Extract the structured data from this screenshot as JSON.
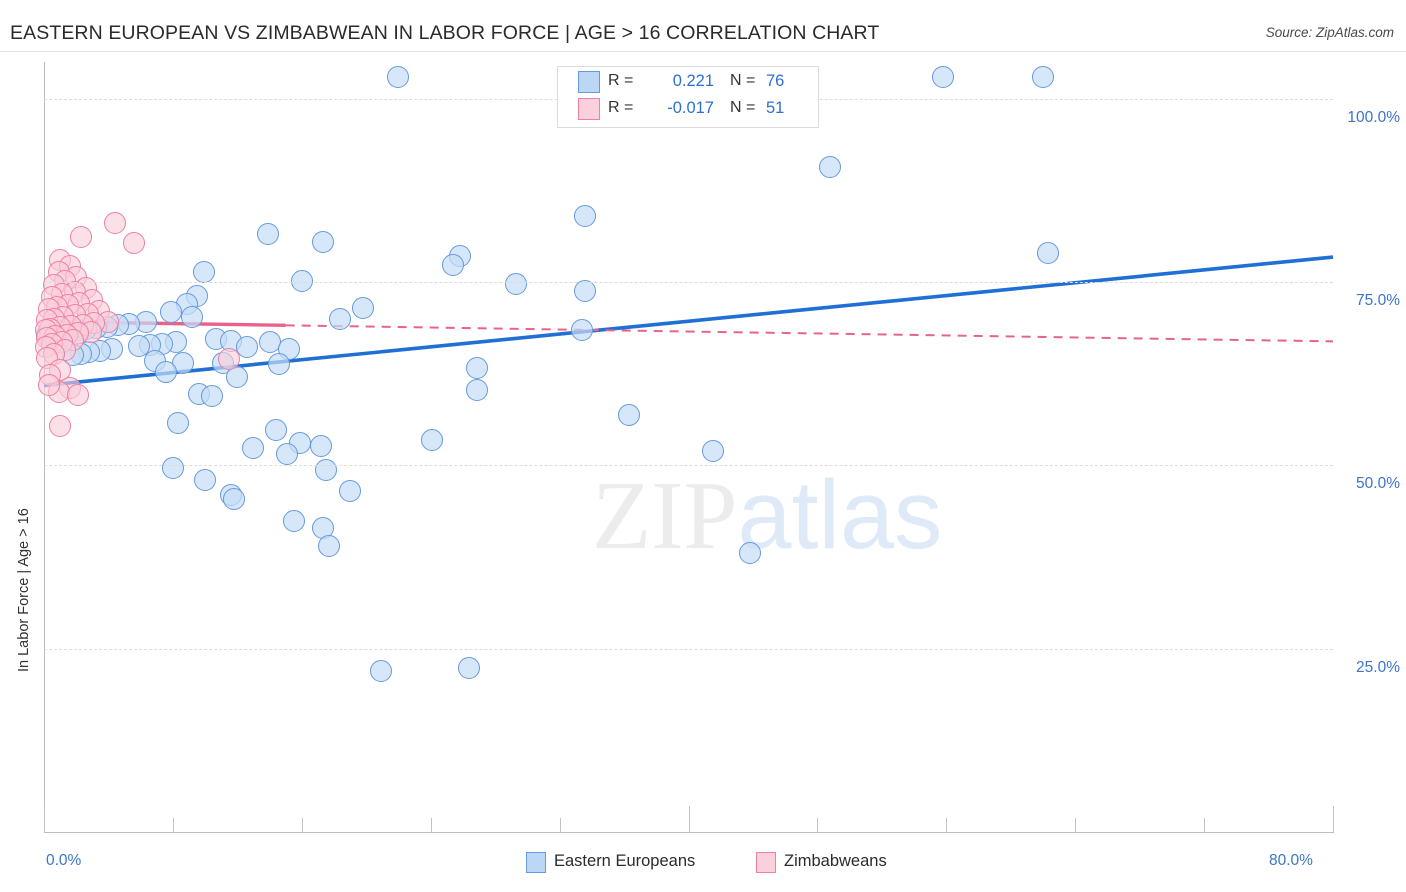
{
  "header": {
    "title": "EASTERN EUROPEAN VS ZIMBABWEAN IN LABOR FORCE | AGE > 16 CORRELATION CHART",
    "source": "Source: ZipAtlas.com"
  },
  "watermark": {
    "part1": "ZIP",
    "part2": "atlas"
  },
  "stats": {
    "rows": [
      {
        "series": "Eastern Europeans",
        "r_label": "R =",
        "r_value": "0.221",
        "n_label": "N =",
        "n_value": "76",
        "color": "#bcd7f5"
      },
      {
        "series": "Zimbabweans",
        "r_label": "R =",
        "r_value": "-0.017",
        "n_label": "N =",
        "n_value": "51",
        "color": "#fbd0dd"
      }
    ]
  },
  "legend": {
    "items": [
      {
        "label": "Eastern Europeans",
        "color": "#bcd7f5"
      },
      {
        "label": "Zimbabweans",
        "color": "#fbd0dd"
      }
    ]
  },
  "chart_data": {
    "type": "scatter",
    "title": "EASTERN EUROPEAN VS ZIMBABWEAN IN LABOR FORCE | AGE > 16 CORRELATION CHART",
    "xlabel": "",
    "ylabel": "In Labor Force | Age > 16",
    "xlim": [
      0,
      80
    ],
    "ylim": [
      0,
      105
    ],
    "grid": true,
    "legend_position": "bottom-center",
    "xticks": [
      "0.0%",
      "80.0%"
    ],
    "xtick_values": [
      0,
      80
    ],
    "yticks": [
      "100.0%",
      "75.0%",
      "50.0%",
      "25.0%"
    ],
    "ytick_values": [
      100,
      75,
      50,
      25
    ],
    "series": [
      {
        "name": "Eastern Europeans",
        "color": "#bcd7f5",
        "border": "#6699dd",
        "r": 0.221,
        "n": 76,
        "trend": {
          "style": "solid",
          "color": "#1f6fd4",
          "x0": 0,
          "y0": 60.9,
          "x1": 80,
          "y1": 78.4
        },
        "points": [
          [
            22.0,
            103.0
          ],
          [
            55.8,
            103.0
          ],
          [
            62.0,
            103.0
          ],
          [
            48.8,
            90.7
          ],
          [
            33.6,
            84.0
          ],
          [
            17.3,
            80.4
          ],
          [
            13.9,
            81.5
          ],
          [
            62.3,
            79.0
          ],
          [
            25.8,
            78.6
          ],
          [
            25.4,
            77.3
          ],
          [
            9.9,
            76.3
          ],
          [
            16.0,
            75.2
          ],
          [
            29.3,
            74.7
          ],
          [
            33.6,
            73.8
          ],
          [
            9.5,
            73.1
          ],
          [
            8.9,
            72.0
          ],
          [
            19.8,
            71.5
          ],
          [
            7.9,
            70.9
          ],
          [
            9.2,
            70.2
          ],
          [
            18.4,
            69.9
          ],
          [
            6.3,
            69.5
          ],
          [
            5.3,
            69.3
          ],
          [
            4.6,
            69.1
          ],
          [
            3.9,
            68.9
          ],
          [
            3.2,
            68.7
          ],
          [
            2.6,
            68.6
          ],
          [
            2.1,
            68.4
          ],
          [
            1.6,
            68.3
          ],
          [
            1.2,
            68.2
          ],
          [
            0.9,
            68.1
          ],
          [
            0.6,
            68.0
          ],
          [
            0.4,
            67.9
          ],
          [
            0.2,
            67.8
          ],
          [
            33.4,
            68.4
          ],
          [
            10.7,
            67.2
          ],
          [
            11.6,
            67.0
          ],
          [
            8.2,
            66.8
          ],
          [
            7.3,
            66.6
          ],
          [
            6.6,
            66.4
          ],
          [
            5.9,
            66.3
          ],
          [
            12.6,
            66.2
          ],
          [
            14.0,
            66.8
          ],
          [
            4.2,
            65.8
          ],
          [
            3.5,
            65.6
          ],
          [
            2.8,
            65.4
          ],
          [
            2.3,
            65.2
          ],
          [
            1.8,
            65.0
          ],
          [
            15.2,
            65.9
          ],
          [
            6.9,
            64.2
          ],
          [
            8.6,
            63.9
          ],
          [
            11.1,
            64.0
          ],
          [
            26.9,
            63.3
          ],
          [
            14.6,
            63.8
          ],
          [
            7.6,
            62.7
          ],
          [
            12.0,
            62.1
          ],
          [
            26.9,
            60.3
          ],
          [
            9.6,
            59.7
          ],
          [
            10.4,
            59.5
          ],
          [
            36.3,
            56.9
          ],
          [
            8.3,
            55.8
          ],
          [
            24.1,
            53.5
          ],
          [
            14.4,
            54.8
          ],
          [
            15.9,
            53.0
          ],
          [
            17.2,
            52.6
          ],
          [
            13.0,
            52.4
          ],
          [
            15.1,
            51.5
          ],
          [
            41.5,
            52.0
          ],
          [
            8.0,
            49.6
          ],
          [
            17.5,
            49.3
          ],
          [
            10.0,
            48.0
          ],
          [
            19.0,
            46.5
          ],
          [
            11.6,
            45.9
          ],
          [
            11.8,
            45.4
          ],
          [
            15.5,
            42.4
          ],
          [
            17.3,
            41.5
          ],
          [
            17.7,
            39.0
          ],
          [
            43.8,
            38.0
          ],
          [
            20.9,
            22.0
          ],
          [
            26.4,
            22.3
          ]
        ]
      },
      {
        "name": "Zimbabweans",
        "color": "#fbd0dd",
        "border": "#ef7fa4",
        "r": -0.017,
        "n": 51,
        "trend": {
          "style": "solid-then-dashed",
          "color": "#e8628c",
          "solid_end_x": 15.0,
          "x0": 0,
          "y0": 69.6,
          "x1": 80,
          "y1": 66.9
        },
        "points": [
          [
            4.4,
            83.0
          ],
          [
            2.3,
            81.1
          ],
          [
            5.6,
            80.3
          ],
          [
            1.0,
            78.0
          ],
          [
            1.6,
            77.2
          ],
          [
            0.9,
            76.4
          ],
          [
            2.0,
            75.7
          ],
          [
            1.3,
            75.1
          ],
          [
            0.6,
            74.6
          ],
          [
            2.6,
            74.2
          ],
          [
            1.9,
            73.7
          ],
          [
            1.1,
            73.3
          ],
          [
            0.5,
            72.9
          ],
          [
            3.0,
            72.6
          ],
          [
            2.2,
            72.2
          ],
          [
            1.5,
            71.9
          ],
          [
            0.8,
            71.6
          ],
          [
            0.3,
            71.3
          ],
          [
            3.4,
            71.0
          ],
          [
            2.7,
            70.7
          ],
          [
            1.9,
            70.5
          ],
          [
            1.2,
            70.2
          ],
          [
            0.6,
            70.0
          ],
          [
            0.2,
            69.8
          ],
          [
            4.0,
            69.6
          ],
          [
            3.1,
            69.4
          ],
          [
            2.4,
            69.2
          ],
          [
            1.7,
            69.0
          ],
          [
            1.0,
            68.8
          ],
          [
            0.4,
            68.6
          ],
          [
            0.1,
            68.4
          ],
          [
            2.9,
            68.2
          ],
          [
            2.1,
            68.0
          ],
          [
            1.4,
            67.8
          ],
          [
            0.7,
            67.6
          ],
          [
            0.2,
            67.4
          ],
          [
            1.8,
            67.1
          ],
          [
            1.1,
            66.8
          ],
          [
            0.5,
            66.5
          ],
          [
            0.1,
            66.2
          ],
          [
            1.3,
            65.7
          ],
          [
            0.6,
            65.2
          ],
          [
            0.2,
            64.7
          ],
          [
            11.5,
            64.5
          ],
          [
            1.0,
            63.0
          ],
          [
            0.4,
            62.3
          ],
          [
            1.6,
            60.6
          ],
          [
            0.9,
            60.0
          ],
          [
            0.3,
            61.0
          ],
          [
            2.1,
            59.6
          ],
          [
            1.0,
            55.3
          ]
        ]
      }
    ]
  }
}
